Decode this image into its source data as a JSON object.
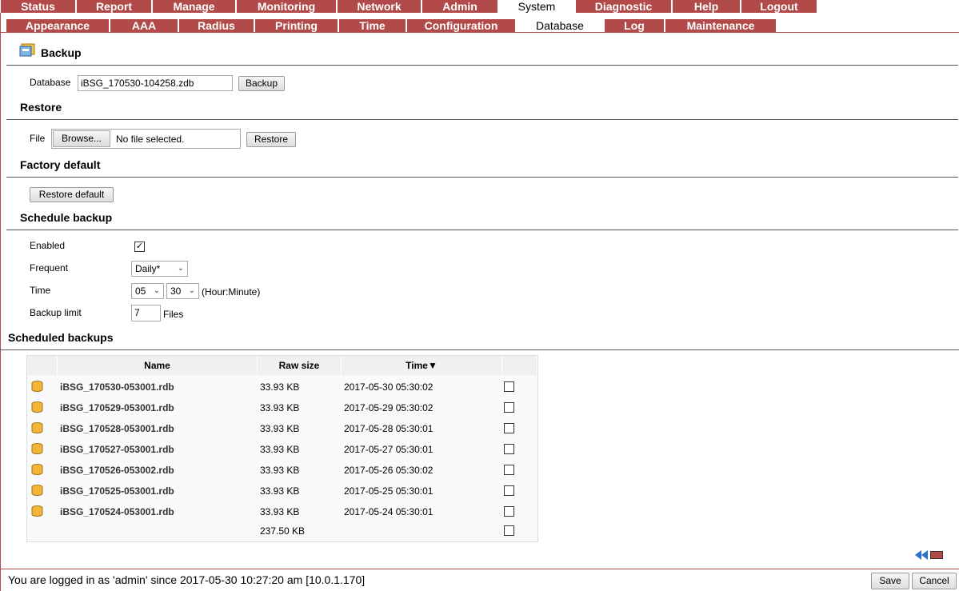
{
  "nav": {
    "main_tabs": [
      "Status",
      "Report",
      "Manage",
      "Monitoring",
      "Network",
      "Admin",
      "System",
      "Diagnostic",
      "Help",
      "Logout"
    ],
    "active_main": "System",
    "sub_tabs": [
      "Appearance",
      "AAA",
      "Radius",
      "Printing",
      "Time",
      "Configuration",
      "Database",
      "Log",
      "Maintenance"
    ],
    "active_sub": "Database"
  },
  "backup": {
    "title": "Backup",
    "database_label": "Database",
    "database_value": "iBSG_170530-104258.zdb",
    "button": "Backup"
  },
  "restore": {
    "title": "Restore",
    "file_label": "File",
    "browse_button": "Browse...",
    "file_status": "No file selected.",
    "button": "Restore"
  },
  "factory": {
    "title": "Factory default",
    "button": "Restore default"
  },
  "schedule": {
    "title": "Schedule backup",
    "enabled_label": "Enabled",
    "enabled_checked": "✓",
    "frequent_label": "Frequent",
    "frequent_value": "Daily*",
    "time_label": "Time",
    "hour_value": "05",
    "minute_value": "30",
    "time_hint": "(Hour:Minute)",
    "limit_label": "Backup limit",
    "limit_value": "7",
    "limit_unit": "Files"
  },
  "scheduled": {
    "title": "Scheduled backups",
    "columns": [
      "Name",
      "Raw size",
      "Time▼"
    ],
    "rows": [
      {
        "name": "iBSG_170530-053001.rdb",
        "size": "33.93 KB",
        "time": "2017-05-30 05:30:02"
      },
      {
        "name": "iBSG_170529-053001.rdb",
        "size": "33.93 KB",
        "time": "2017-05-29 05:30:02"
      },
      {
        "name": "iBSG_170528-053001.rdb",
        "size": "33.93 KB",
        "time": "2017-05-28 05:30:01"
      },
      {
        "name": "iBSG_170527-053001.rdb",
        "size": "33.93 KB",
        "time": "2017-05-27 05:30:01"
      },
      {
        "name": "iBSG_170526-053002.rdb",
        "size": "33.93 KB",
        "time": "2017-05-26 05:30:02"
      },
      {
        "name": "iBSG_170525-053001.rdb",
        "size": "33.93 KB",
        "time": "2017-05-25 05:30:01"
      },
      {
        "name": "iBSG_170524-053001.rdb",
        "size": "33.93 KB",
        "time": "2017-05-24 05:30:01"
      }
    ],
    "total_size": "237.50 KB"
  },
  "status_bar": {
    "text": "You are logged in as 'admin' since 2017-05-30 10:27:20 am [10.0.1.170]",
    "save": "Save",
    "cancel": "Cancel"
  },
  "colors": {
    "tab_bg": "#b34a4a",
    "db_icon": "#f2b53a"
  }
}
